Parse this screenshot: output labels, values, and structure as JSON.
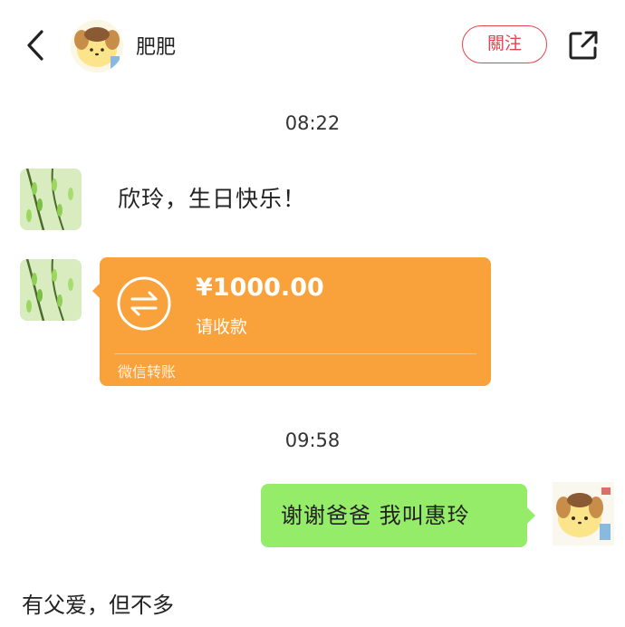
{
  "header": {
    "username": "肥肥",
    "follow_label": "關注",
    "back_icon": "chevron-left-icon",
    "share_icon": "external-share-icon"
  },
  "messages": {
    "time_1": "08:22",
    "text_1": "欣玲，生日快乐！",
    "transfer": {
      "amount": "¥1000.00",
      "status": "请收款",
      "footer": "微信转账",
      "color": "#f9a13a"
    },
    "time_2": "09:58",
    "reply": "谢谢爸爸 我叫惠玲",
    "reply_color": "#95ec69"
  },
  "caption": "有父爱，但不多",
  "colors": {
    "follow_accent": "#e0454f"
  }
}
